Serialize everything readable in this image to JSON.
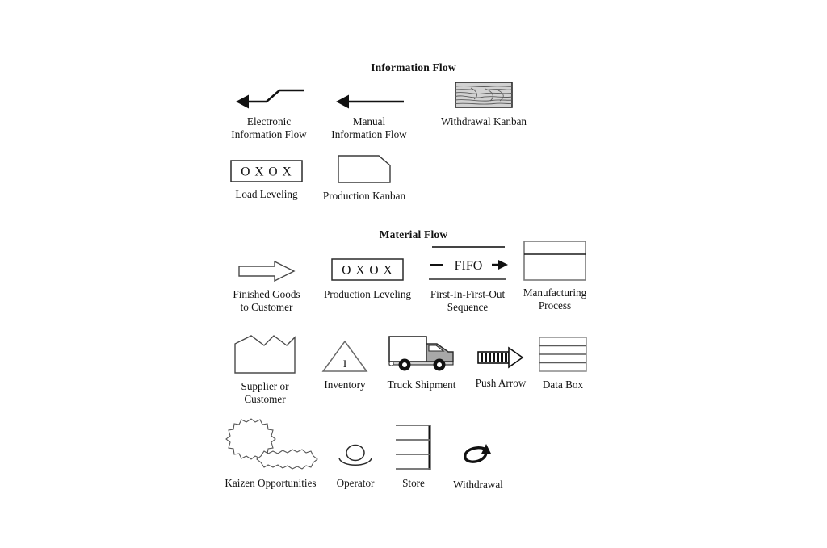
{
  "page": {
    "background_color": "#ffffff",
    "line_color": "#3a3a3a",
    "dark_color": "#111111",
    "fill_gray": "#d9d9d9"
  },
  "sections": [
    {
      "id": "information-flow",
      "title": "Information Flow"
    },
    {
      "id": "material-flow",
      "title": "Material Flow"
    }
  ],
  "symbols": {
    "electronic_information_flow": {
      "label": "Electronic\nInformation Flow",
      "icon": "electronic-information-flow-icon"
    },
    "manual_information_flow": {
      "label": "Manual\nInformation Flow",
      "icon": "manual-information-flow-icon"
    },
    "withdrawal_kanban": {
      "label": "Withdrawal Kanban",
      "icon": "withdrawal-kanban-icon"
    },
    "load_leveling": {
      "label": "Load Leveling",
      "icon": "load-leveling-icon",
      "inner_text": "O X  O X"
    },
    "production_kanban": {
      "label": "Production Kanban",
      "icon": "production-kanban-icon"
    },
    "finished_goods": {
      "label": "Finished Goods\nto Customer",
      "icon": "finished-goods-arrow-icon"
    },
    "production_leveling": {
      "label": "Production Leveling",
      "icon": "production-leveling-icon",
      "inner_text": "O X  O X"
    },
    "fifo": {
      "label": "First-In-First-Out\nSequence",
      "icon": "fifo-icon",
      "inner_text": "FIFO"
    },
    "manufacturing_process": {
      "label": "Manufacturing\nProcess",
      "icon": "manufacturing-process-icon"
    },
    "supplier_customer": {
      "label": "Supplier or\nCustomer",
      "icon": "supplier-customer-factory-icon"
    },
    "inventory": {
      "label": "Inventory",
      "icon": "inventory-triangle-icon",
      "inner_text": "I"
    },
    "truck_shipment": {
      "label": "Truck Shipment",
      "icon": "truck-shipment-icon"
    },
    "push_arrow": {
      "label": "Push Arrow",
      "icon": "push-arrow-icon"
    },
    "data_box": {
      "label": "Data Box",
      "icon": "data-box-icon"
    },
    "kaizen": {
      "label": "Kaizen Opportunities",
      "icon": "kaizen-burst-icon"
    },
    "operator": {
      "label": "Operator",
      "icon": "operator-icon"
    },
    "store": {
      "label": "Store",
      "icon": "store-shelf-icon"
    },
    "withdrawal": {
      "label": "Withdrawal",
      "icon": "withdrawal-circular-arrow-icon"
    }
  }
}
